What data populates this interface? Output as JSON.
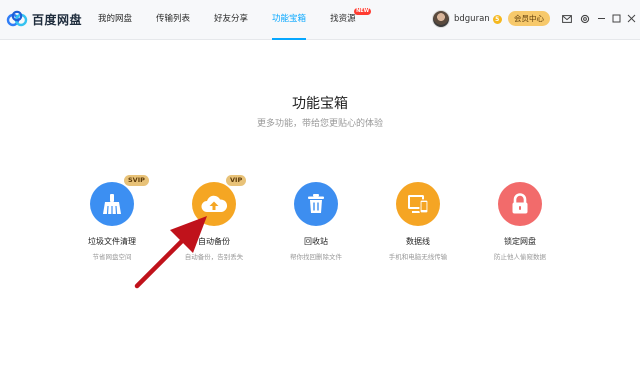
{
  "app": {
    "name": "百度网盘"
  },
  "nav": {
    "items": [
      {
        "label": "我的网盘"
      },
      {
        "label": "传输列表"
      },
      {
        "label": "好友分享"
      },
      {
        "label": "功能宝箱"
      },
      {
        "label": "找资源",
        "badge": "NEW"
      }
    ],
    "active_index": 3
  },
  "user": {
    "name": "bdguran",
    "level": "5"
  },
  "vip_button": {
    "label": "会员中心"
  },
  "header": {
    "title": "功能宝箱",
    "subtitle": "更多功能，带给您更贴心的体验"
  },
  "tools": [
    {
      "name": "垃圾文件清理",
      "desc": "节省网盘空间",
      "badge": "SVIP",
      "color": "#3c8ff2",
      "icon": "broom-icon"
    },
    {
      "name": "自动备份",
      "desc": "自动备份，告别丢失",
      "badge": "VIP",
      "color": "#f5a623",
      "icon": "cloud-upload-icon"
    },
    {
      "name": "回收站",
      "desc": "帮你找回删除文件",
      "color": "#3d8ef0",
      "icon": "trash-icon"
    },
    {
      "name": "数据线",
      "desc": "手机和电脑无线传输",
      "color": "#f5a524",
      "icon": "devices-icon"
    },
    {
      "name": "锁定网盘",
      "desc": "防止他人偷窥数据",
      "color": "#f26b6b",
      "icon": "lock-icon"
    }
  ],
  "colors": {
    "accent": "#06a7ff",
    "arrow": "#c0121b"
  }
}
